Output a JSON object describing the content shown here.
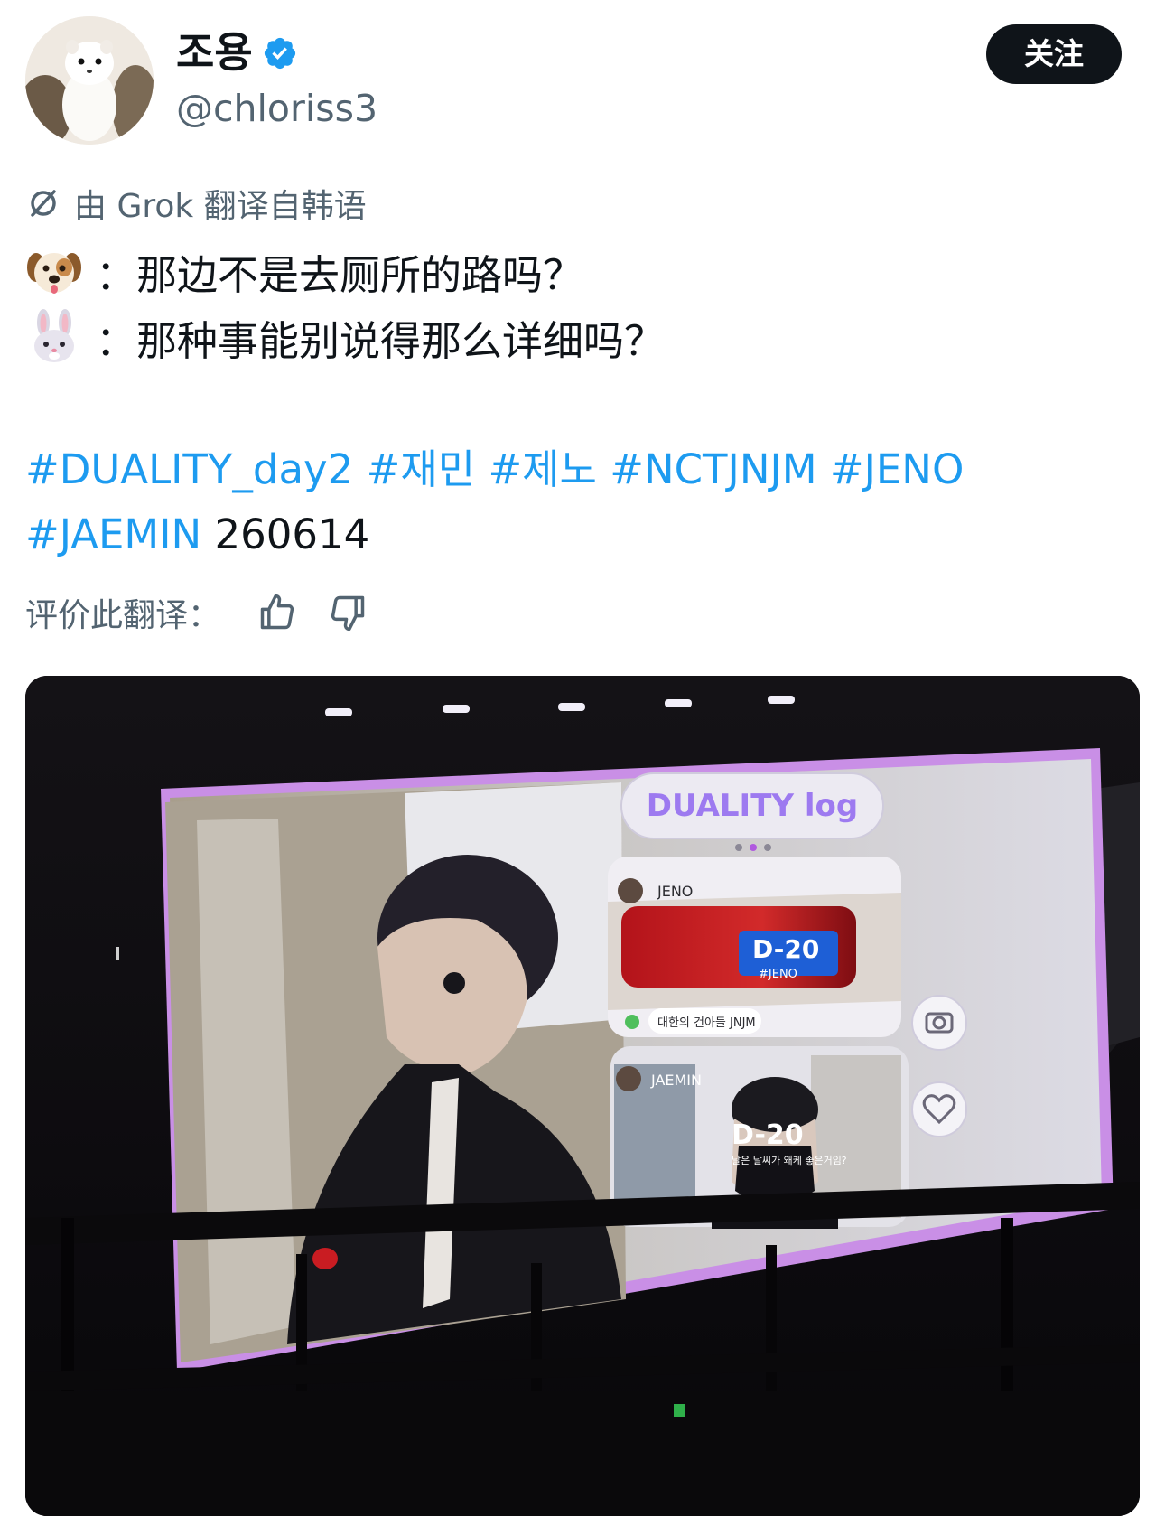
{
  "author": {
    "display_name": "조용",
    "handle": "@chloriss3",
    "verified": true,
    "follow_label": "关注"
  },
  "translation_notice": "由 Grok 翻译自韩语",
  "tweet": {
    "lines": [
      {
        "emoji": "dog-face-emoji",
        "text": "：那边不是去厕所的路吗？"
      },
      {
        "emoji": "rabbit-face-emoji",
        "text": "：那种事能别说得那么详细吗？"
      }
    ],
    "hashtags": [
      "#DUALITY_day2",
      "#재민",
      "#제노",
      "#NCTJNJM",
      "#JENO",
      "#JAEMIN"
    ],
    "date_text": "260614"
  },
  "rate_translation": {
    "label": "评价此翻译："
  },
  "media": {
    "screen_title": "DUALITY log",
    "card1": {
      "user": "JENO",
      "countdown": "D-20",
      "tag": "#JENO",
      "caption": "대한의 건아들 JNJM"
    },
    "card2": {
      "user": "JAEMIN",
      "countdown": "D-20",
      "caption": "날은 날씨가 왜케 좋은거임?"
    }
  },
  "colors": {
    "link": "#1d9bf0",
    "text": "#0f1419",
    "muted": "#536471",
    "verified": "#1d9bf0",
    "screen_border": "#c98fe6",
    "logo_purple": "#9d7af0"
  }
}
